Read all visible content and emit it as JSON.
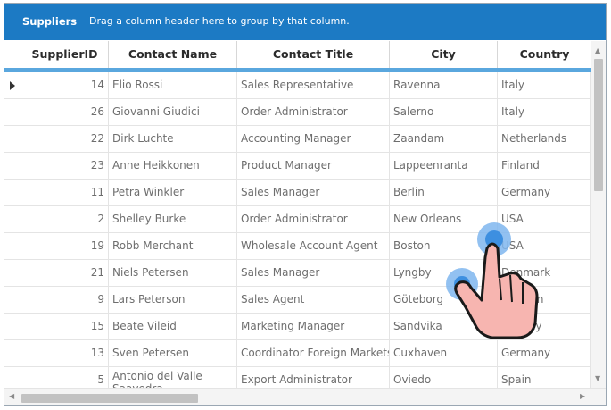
{
  "group_panel": {
    "title": "Suppliers",
    "hint": "Drag a column header here to group by that column."
  },
  "columns": [
    "SupplierID",
    "Contact Name",
    "Contact Title",
    "City",
    "Country"
  ],
  "rows": [
    {
      "id": "14",
      "name": "Elio Rossi",
      "title": "Sales Representative",
      "city": "Ravenna",
      "country": "Italy"
    },
    {
      "id": "26",
      "name": "Giovanni Giudici",
      "title": "Order Administrator",
      "city": "Salerno",
      "country": "Italy"
    },
    {
      "id": "22",
      "name": "Dirk Luchte",
      "title": "Accounting Manager",
      "city": "Zaandam",
      "country": "Netherlands"
    },
    {
      "id": "23",
      "name": "Anne Heikkonen",
      "title": "Product Manager",
      "city": "Lappeenranta",
      "country": "Finland"
    },
    {
      "id": "11",
      "name": "Petra Winkler",
      "title": "Sales Manager",
      "city": "Berlin",
      "country": "Germany"
    },
    {
      "id": "2",
      "name": "Shelley Burke",
      "title": "Order Administrator",
      "city": "New Orleans",
      "country": "USA"
    },
    {
      "id": "19",
      "name": "Robb Merchant",
      "title": "Wholesale Account Agent",
      "city": "Boston",
      "country": "USA"
    },
    {
      "id": "21",
      "name": "Niels Petersen",
      "title": "Sales Manager",
      "city": "Lyngby",
      "country": "Denmark"
    },
    {
      "id": "9",
      "name": "Lars Peterson",
      "title": "Sales Agent",
      "city": "Göteborg",
      "country": "Sweden"
    },
    {
      "id": "15",
      "name": "Beate Vileid",
      "title": "Marketing Manager",
      "city": "Sandvika",
      "country": "Norway"
    },
    {
      "id": "13",
      "name": "Sven Petersen",
      "title": "Coordinator Foreign Markets",
      "city": "Cuxhaven",
      "country": "Germany"
    },
    {
      "id": "5",
      "name": "Antonio del Valle Saavedra",
      "title": "Export Administrator",
      "city": "Oviedo",
      "country": "Spain"
    }
  ],
  "current_row": 0,
  "colors": {
    "group_panel": "#1c7ac4",
    "header_accent": "#5aa7de",
    "touch_hand": "#f7b5b0",
    "touch_point": "#3d8fe0"
  },
  "icons": {
    "current_row": "right-triangle",
    "scroll_up": "up-triangle",
    "scroll_down": "down-triangle",
    "scroll_left": "left-triangle",
    "scroll_right": "right-triangle",
    "gesture": "pinch-hand"
  }
}
